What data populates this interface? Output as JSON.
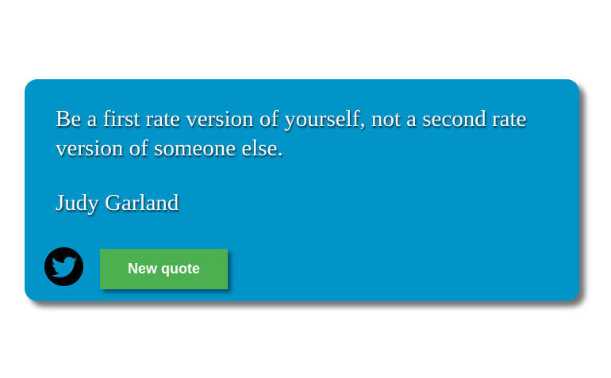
{
  "quote": {
    "text": "Be a first rate version of yourself, not a second rate version of someone else.",
    "author": "Judy Garland"
  },
  "actions": {
    "tweet_icon": "twitter-icon",
    "new_quote_label": "New quote"
  },
  "colors": {
    "card_background": "#0094c8",
    "button_background": "#4caf50",
    "icon_background": "#000000",
    "icon_foreground": "#0094c8",
    "text": "#ffffff"
  }
}
